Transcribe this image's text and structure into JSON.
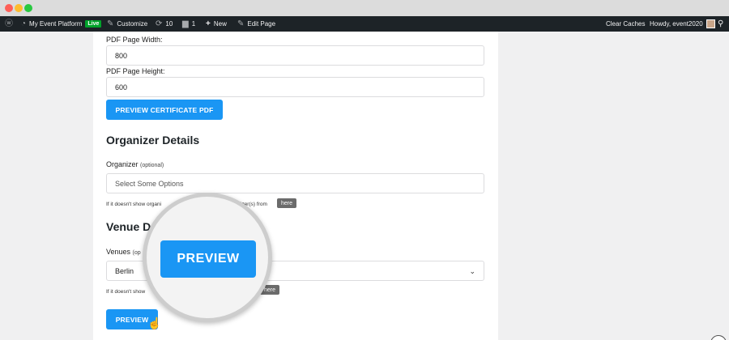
{
  "adminbar": {
    "site_name": "My Event Platform",
    "live_badge": "Live",
    "customize": "Customize",
    "updates_count": "10",
    "comments_count": "1",
    "new": "New",
    "edit_page": "Edit Page",
    "clear_caches": "Clear Caches",
    "howdy": "Howdy, event2020"
  },
  "form": {
    "pdf_width_label": "PDF Page Width:",
    "pdf_width_value": "800",
    "pdf_height_label": "PDF Page Height:",
    "pdf_height_value": "600",
    "preview_certificate_label": "PREVIEW CERTIFICATE PDF",
    "organizer_heading": "Organizer Details",
    "organizer_label": "Organizer",
    "optional": "(optional)",
    "organizer_placeholder": "Select Some Options",
    "organizer_help_start": "If it doesn't show organi",
    "organizer_help_end": "izer(s) from",
    "here_label": "here",
    "venue_heading": "Venue D",
    "venues_label": "Venues",
    "venues_optional": "(op",
    "venue_value": "Berlin",
    "venue_help_start": "If it doesn't show",
    "here_partial": "here",
    "preview_label": "PREVIEW"
  },
  "magnifier": {
    "preview_label": "PREVIEW"
  },
  "colors": {
    "accent": "#1a96f4",
    "adminbar": "#1d2327",
    "live": "#00a32a"
  }
}
